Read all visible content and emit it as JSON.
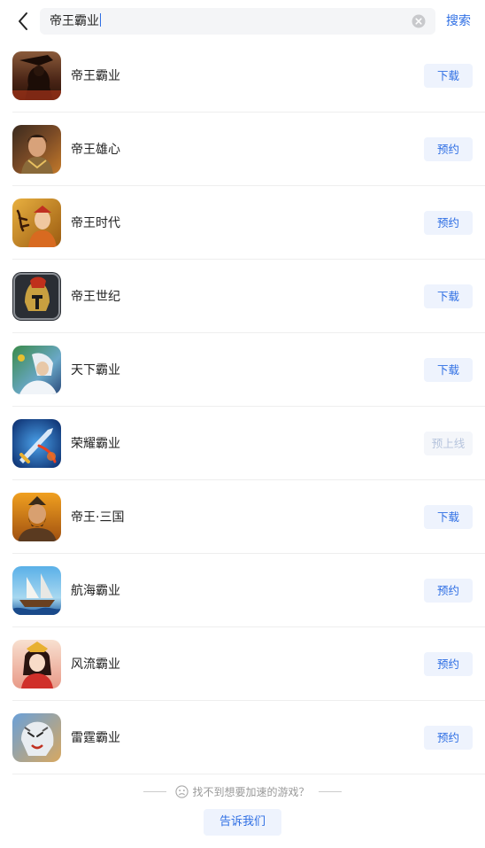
{
  "search": {
    "query": "帝王霸业",
    "submit_label": "搜索"
  },
  "results": [
    {
      "name": "帝王霸业",
      "action": "下载",
      "action_state": "enabled"
    },
    {
      "name": "帝王雄心",
      "action": "预约",
      "action_state": "enabled"
    },
    {
      "name": "帝王时代",
      "action": "预约",
      "action_state": "enabled"
    },
    {
      "name": "帝王世纪",
      "action": "下载",
      "action_state": "enabled"
    },
    {
      "name": "天下霸业",
      "action": "下载",
      "action_state": "enabled"
    },
    {
      "name": "荣耀霸业",
      "action": "预上线",
      "action_state": "disabled"
    },
    {
      "name": "帝王·三国",
      "action": "下载",
      "action_state": "enabled"
    },
    {
      "name": "航海霸业",
      "action": "预约",
      "action_state": "enabled"
    },
    {
      "name": "风流霸业",
      "action": "预约",
      "action_state": "enabled"
    },
    {
      "name": "雷霆霸业",
      "action": "预约",
      "action_state": "enabled"
    }
  ],
  "footer": {
    "hint": "找不到想要加速的游戏？",
    "feedback_label": "告诉我们"
  },
  "colors": {
    "accent": "#2f6fe4",
    "button_bg": "#eef3fd",
    "disabled_text": "#b6c4dd"
  },
  "icons": {
    "back": "chevron-left-icon",
    "clear": "clear-circle-icon",
    "hint": "sad-face-icon"
  }
}
